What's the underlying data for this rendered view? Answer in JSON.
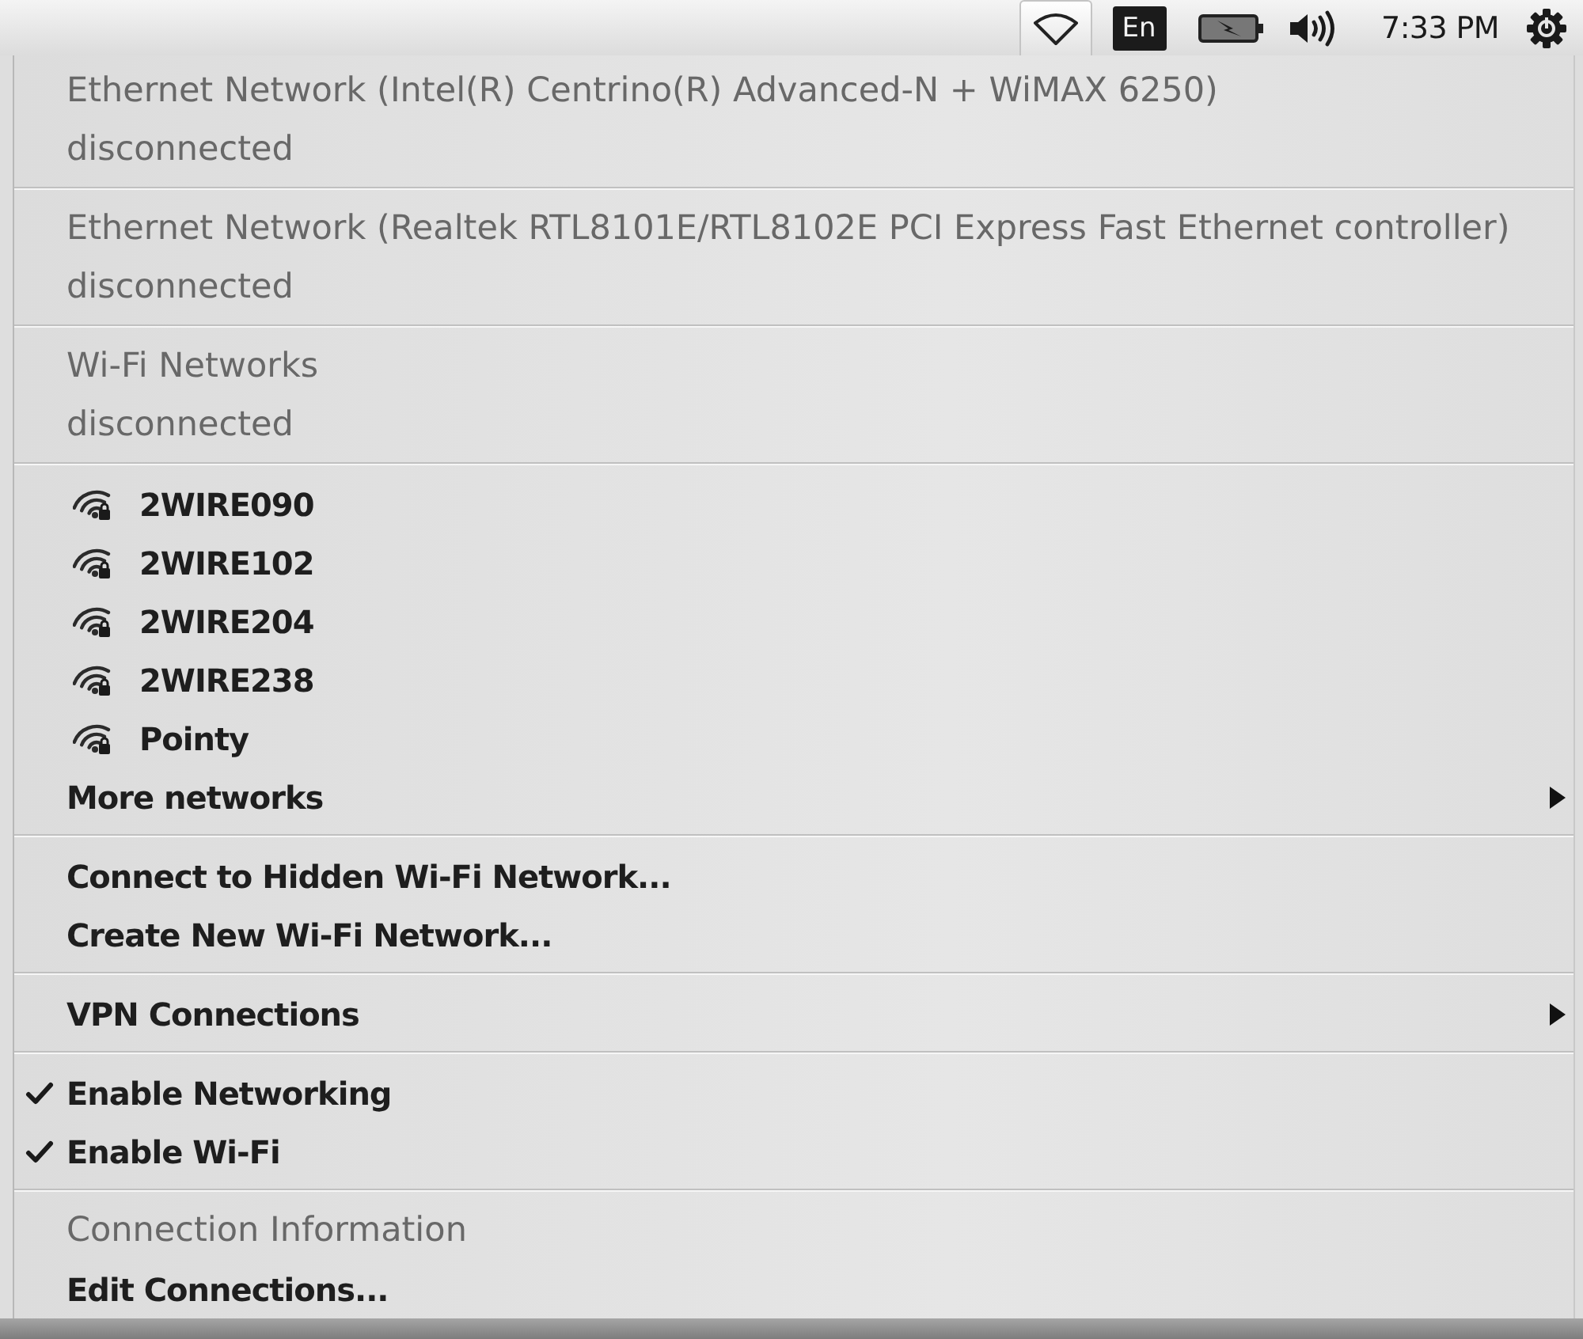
{
  "top_bar": {
    "indicators": [
      {
        "kind": "network",
        "selected": true
      },
      {
        "kind": "keyboard",
        "label": "En",
        "selected": false
      },
      {
        "kind": "battery",
        "selected": false
      },
      {
        "kind": "volume",
        "selected": false
      },
      {
        "kind": "clock",
        "label": "7:33 PM",
        "selected": false
      },
      {
        "kind": "session",
        "selected": false
      }
    ]
  },
  "menu": {
    "sections": [
      {
        "items": [
          {
            "kind": "header",
            "label": "Ethernet Network (Intel(R) Centrino(R) Advanced-N + WiMAX 6250)",
            "disabled": true,
            "submenu": false
          },
          {
            "kind": "status",
            "label": "disconnected",
            "disabled": true,
            "submenu": false
          }
        ]
      },
      {
        "items": [
          {
            "kind": "header",
            "label": "Ethernet Network (Realtek RTL8101E/RTL8102E PCI Express Fast Ethernet controller)",
            "disabled": true,
            "submenu": false
          },
          {
            "kind": "status",
            "label": "disconnected",
            "disabled": true,
            "submenu": false
          }
        ]
      },
      {
        "items": [
          {
            "kind": "header",
            "label": "Wi-Fi Networks",
            "disabled": true,
            "submenu": false
          },
          {
            "kind": "status",
            "label": "disconnected",
            "disabled": true,
            "submenu": false
          }
        ]
      },
      {
        "items": [
          {
            "kind": "network",
            "label": "2WIRE090",
            "disabled": false,
            "submenu": false
          },
          {
            "kind": "network",
            "label": "2WIRE102",
            "disabled": false,
            "submenu": false
          },
          {
            "kind": "network",
            "label": "2WIRE204",
            "disabled": false,
            "submenu": false
          },
          {
            "kind": "network",
            "label": "2WIRE238",
            "disabled": false,
            "submenu": false
          },
          {
            "kind": "network",
            "label": "Pointy",
            "disabled": false,
            "submenu": false
          },
          {
            "kind": "text",
            "label": "More networks",
            "disabled": false,
            "submenu": true
          }
        ]
      },
      {
        "items": [
          {
            "kind": "text",
            "label": "Connect to Hidden Wi-Fi Network...",
            "disabled": false,
            "submenu": false
          },
          {
            "kind": "text",
            "label": "Create New Wi-Fi Network...",
            "disabled": false,
            "submenu": false
          }
        ]
      },
      {
        "items": [
          {
            "kind": "text",
            "label": "VPN Connections",
            "disabled": false,
            "submenu": true
          }
        ]
      },
      {
        "items": [
          {
            "kind": "check",
            "label": "Enable Networking",
            "checked": true,
            "disabled": false,
            "submenu": false
          },
          {
            "kind": "check",
            "label": "Enable Wi-Fi",
            "checked": true,
            "disabled": false,
            "submenu": false
          }
        ]
      },
      {
        "items": [
          {
            "kind": "text",
            "label": "Connection Information",
            "disabled": true,
            "submenu": false
          },
          {
            "kind": "text",
            "label": "Edit Connections...",
            "disabled": false,
            "submenu": false
          }
        ]
      }
    ]
  }
}
